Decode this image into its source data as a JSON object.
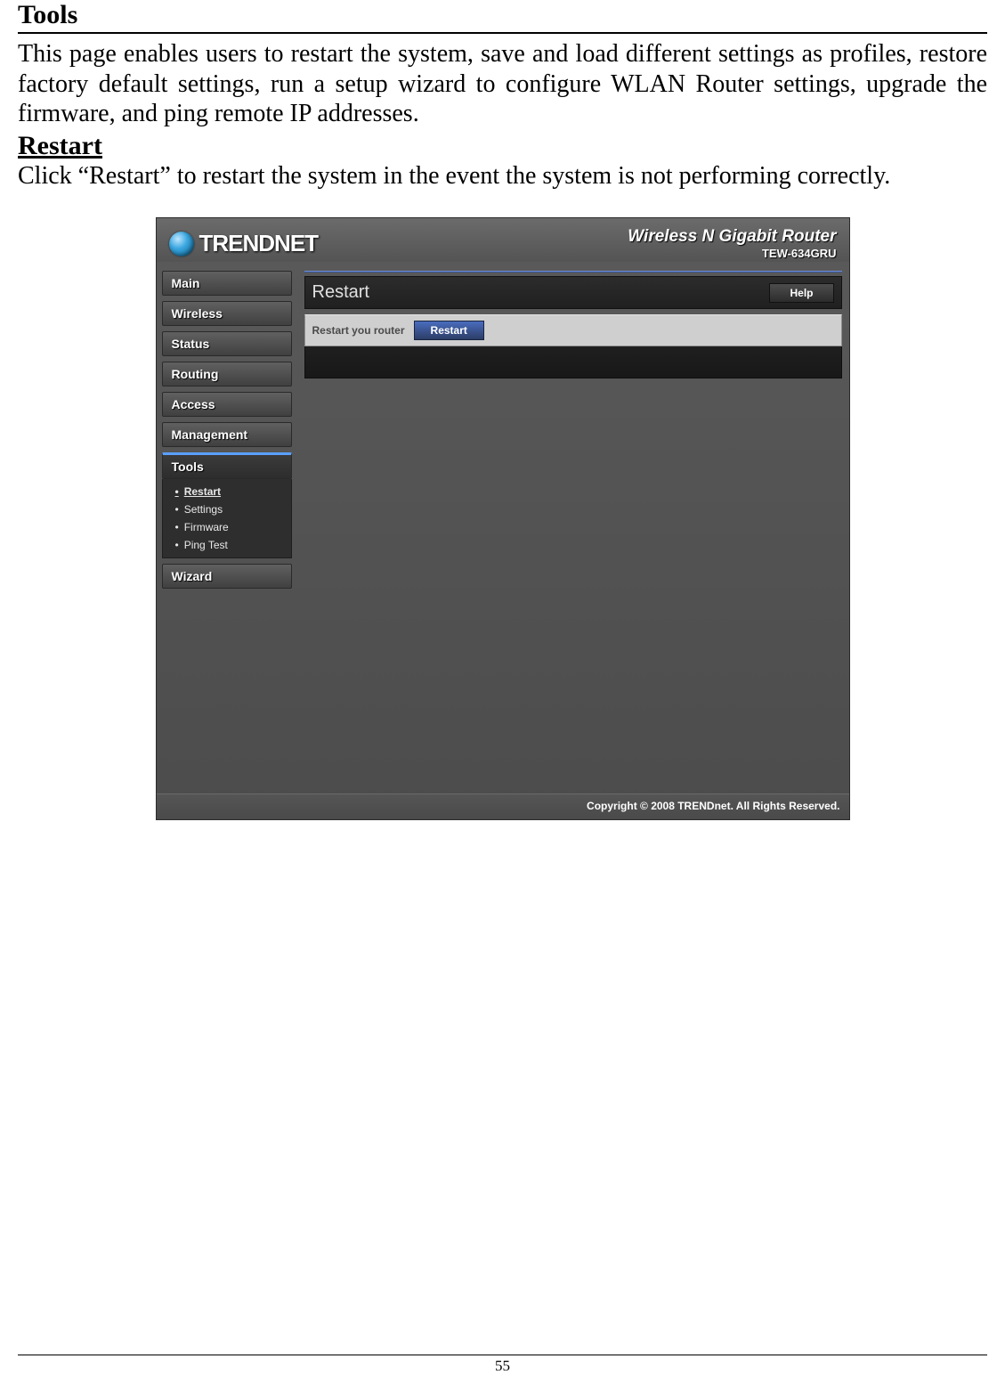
{
  "doc": {
    "title": "Tools",
    "para1": "This page enables users to restart the system, save and load different settings as profiles, restore factory default settings, run a setup wizard to configure WLAN Router settings, upgrade the firmware, and ping remote IP addresses.",
    "subtitle": "Restart",
    "para2": "Click “Restart” to restart the system in the event the system is not performing correctly.",
    "page_number": "55"
  },
  "router": {
    "brand": "TRENDNET",
    "product_title": "Wireless N Gigabit Router",
    "product_model": "TEW-634GRU",
    "footer": "Copyright © 2008 TRENDnet. All Rights Reserved.",
    "nav": {
      "items": [
        "Main",
        "Wireless",
        "Status",
        "Routing",
        "Access",
        "Management",
        "Tools",
        "Wizard"
      ],
      "active": "Tools",
      "tools_sub": [
        "Restart",
        "Settings",
        "Firmware",
        "Ping Test"
      ],
      "tools_sub_current": "Restart"
    },
    "content": {
      "heading": "Restart",
      "help_label": "Help",
      "row_label": "Restart you router",
      "button_label": "Restart"
    }
  }
}
